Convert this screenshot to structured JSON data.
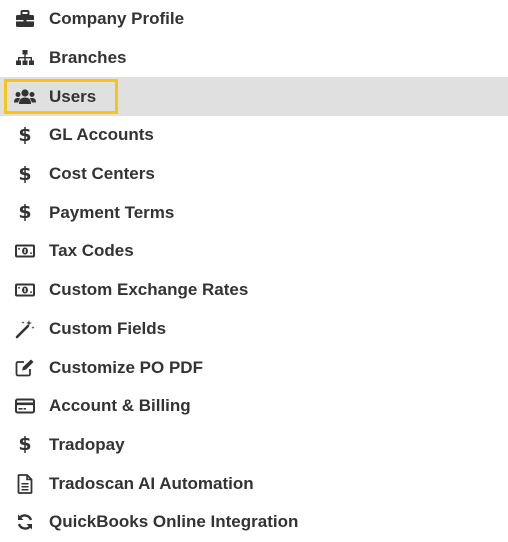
{
  "settings_menu": {
    "accent_highlight": "#f5c518",
    "active_background": "#e0e0e0",
    "items": [
      {
        "label": "Company Profile",
        "icon": "briefcase-icon"
      },
      {
        "label": "Branches",
        "icon": "sitemap-icon"
      },
      {
        "label": "Users",
        "icon": "users-icon",
        "active": true
      },
      {
        "label": "GL Accounts",
        "icon": "dollar-icon"
      },
      {
        "label": "Cost Centers",
        "icon": "dollar-icon"
      },
      {
        "label": "Payment Terms",
        "icon": "dollar-icon"
      },
      {
        "label": "Tax Codes",
        "icon": "money-bill-icon"
      },
      {
        "label": "Custom Exchange Rates",
        "icon": "money-bill-icon"
      },
      {
        "label": "Custom Fields",
        "icon": "magic-wand-icon"
      },
      {
        "label": "Customize PO PDF",
        "icon": "edit-icon"
      },
      {
        "label": "Account & Billing",
        "icon": "credit-card-icon"
      },
      {
        "label": "Tradopay",
        "icon": "dollar-icon"
      },
      {
        "label": "Tradoscan AI Automation",
        "icon": "file-text-icon"
      },
      {
        "label": "QuickBooks Online Integration",
        "icon": "sync-icon"
      }
    ]
  }
}
